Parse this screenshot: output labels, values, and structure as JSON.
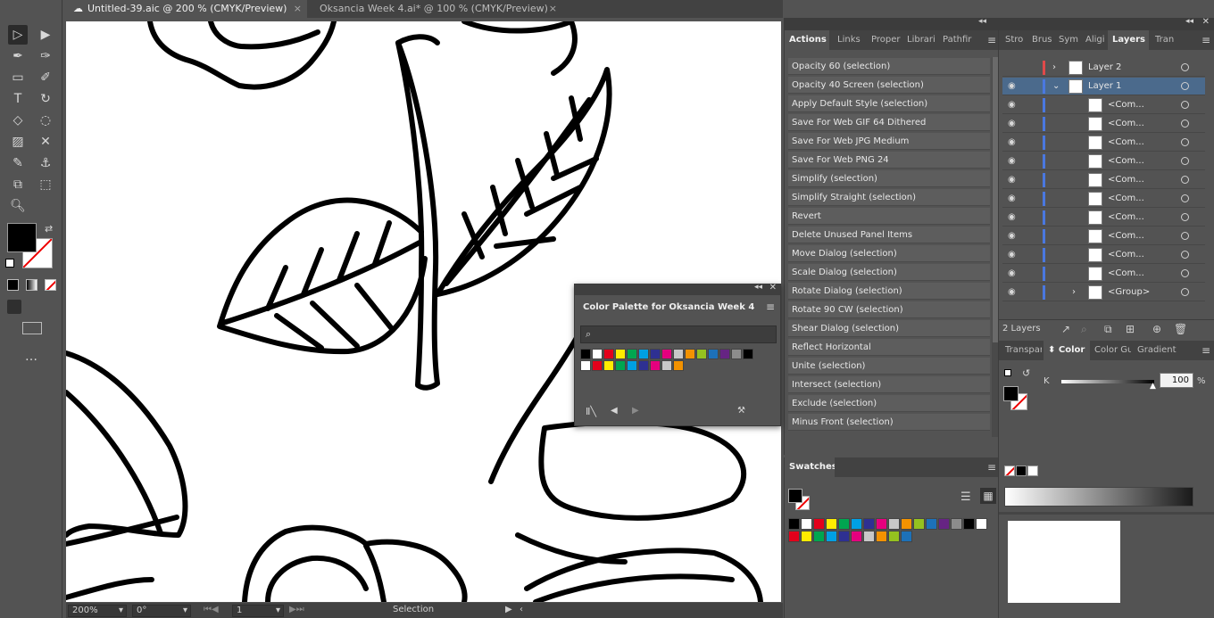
{
  "doc_tabs": [
    {
      "label": "Untitled-39.aic @ 200 % (CMYK/Preview)",
      "close": "×"
    },
    {
      "label": "Oksancia Week 4.ai* @ 100 % (CMYK/Preview)",
      "close": "×"
    }
  ],
  "status": {
    "zoom": "200%",
    "rotation": "0°",
    "artboard": "1",
    "tool": "Selection"
  },
  "actions_panel": {
    "tabs": [
      "Actions",
      "Links",
      "Proper",
      "Librari",
      "Pathfir"
    ],
    "items": [
      "Opacity 60 (selection)",
      "Opacity 40 Screen (selection)",
      "Apply Default Style (selection)",
      "Save For Web GIF 64 Dithered",
      "Save For Web JPG Medium",
      "Save For Web PNG 24",
      "Simplify (selection)",
      "Simplify Straight (selection)",
      "Revert",
      "Delete Unused Panel Items",
      "Move Dialog (selection)",
      "Scale Dialog (selection)",
      "Rotate Dialog (selection)",
      "Rotate 90 CW (selection)",
      "Shear Dialog (selection)",
      "Reflect Horizontal",
      "Unite (selection)",
      "Intersect (selection)",
      "Exclude (selection)",
      "Minus Front (selection)"
    ]
  },
  "layers_panel": {
    "tabs": [
      "Stro",
      "Brus",
      "Sym",
      "Aligi",
      "Layers",
      "Tran"
    ],
    "rows": [
      {
        "name": "Layer 2",
        "bar": "#e04a4a"
      },
      {
        "name": "Layer 1",
        "bar": "#4a78e0"
      },
      {
        "name": "<Com...",
        "bar": "#4a78e0"
      },
      {
        "name": "<Com...",
        "bar": "#4a78e0"
      },
      {
        "name": "<Com...",
        "bar": "#4a78e0"
      },
      {
        "name": "<Com...",
        "bar": "#4a78e0"
      },
      {
        "name": "<Com...",
        "bar": "#4a78e0"
      },
      {
        "name": "<Com...",
        "bar": "#4a78e0"
      },
      {
        "name": "<Com...",
        "bar": "#4a78e0"
      },
      {
        "name": "<Com...",
        "bar": "#4a78e0"
      },
      {
        "name": "<Com...",
        "bar": "#4a78e0"
      },
      {
        "name": "<Com...",
        "bar": "#4a78e0"
      },
      {
        "name": "<Group>",
        "bar": "#4a78e0"
      }
    ],
    "count": "2 Layers"
  },
  "color_panel": {
    "tabs": [
      "Transpar",
      "Color",
      "Color Gu",
      "Gradient"
    ],
    "channel": "K",
    "value": "100",
    "value_level_percent": 100,
    "unit": "%"
  },
  "swatches_panel": {
    "title": "Swatches"
  },
  "floating_palette": {
    "title": "Color Palette for Oksancia Week 4"
  },
  "swatch_colors": [
    "#000000",
    "#ffffff",
    "#e3001b",
    "#ffec00",
    "#00a650",
    "#00a0e3",
    "#2e3092",
    "#e5007e",
    "#c8c8c8",
    "#f39200",
    "#95c11f",
    "#1d71b8",
    "#662483",
    "#8c8c8c"
  ]
}
